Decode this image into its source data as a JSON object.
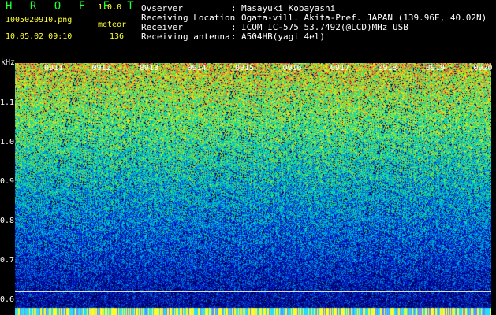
{
  "header": {
    "app_title": "H R O F F T",
    "version": "1.0.0",
    "file_name": "1005020910.png",
    "mode": "meteor",
    "datetime": "10.05.02 09:10",
    "count": "136"
  },
  "info": [
    {
      "label": "Ovserver",
      "value": "Masayuki Kobayashi"
    },
    {
      "label": "Receiving Location",
      "value": "Ogata-vill. Akita-Pref. JAPAN (139.96E, 40.02N)"
    },
    {
      "label": "Receiver",
      "value": "ICOM IC-575 53.7492(@LCD)MHz USB"
    },
    {
      "label": "Receiving antenna",
      "value": "A504HB(yagi 4el)"
    }
  ],
  "separator": ":",
  "axis": {
    "y_unit": "kHz",
    "y_ticks": [
      "1.1",
      "1.0",
      "0.9",
      "0.8",
      "0.7",
      "0.6"
    ],
    "x_ticks": [
      "0911",
      "0912",
      "0913",
      "0914",
      "0915",
      "0916",
      "0917",
      "0918",
      "0919",
      "0920"
    ]
  }
}
